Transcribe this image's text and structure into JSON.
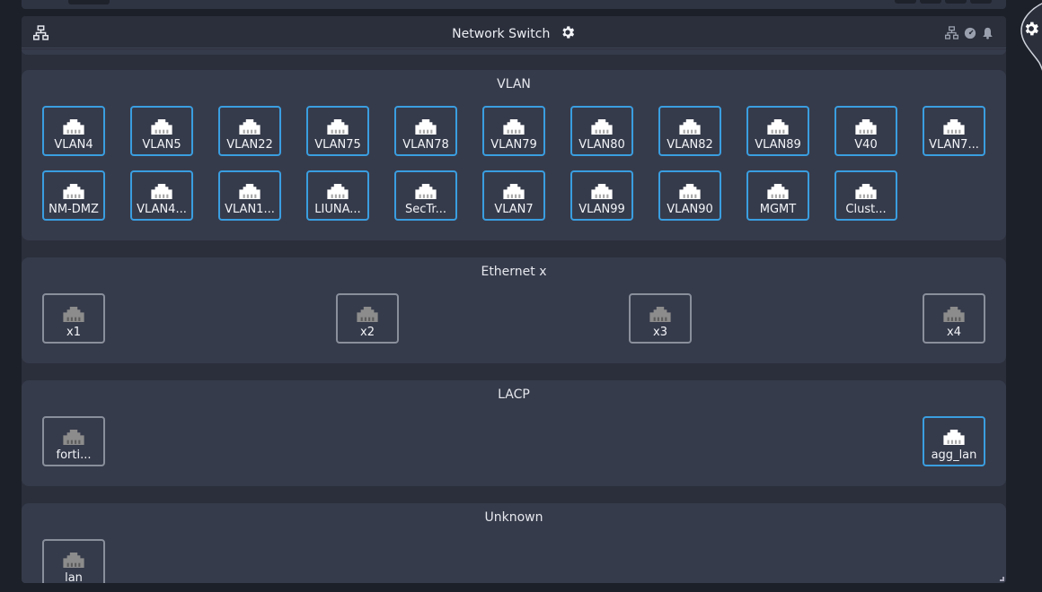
{
  "header": {
    "title": "Network Switch",
    "icons": [
      "network-icon",
      "gear-icon",
      "network-icon",
      "dashboard-icon",
      "bell-icon"
    ]
  },
  "colors": {
    "background": "#1c2028",
    "card": "#2b2f3c",
    "section": "#363b4b",
    "active_border": "#3a9ee0",
    "inactive_border": "#8a8f9c",
    "active_icon": "#ffffff",
    "inactive_icon": "#8c8c8c"
  },
  "sections": {
    "vlan": {
      "title": "VLAN",
      "items": [
        {
          "label": "VLAN4",
          "active": true
        },
        {
          "label": "VLAN5",
          "active": true
        },
        {
          "label": "VLAN22",
          "active": true
        },
        {
          "label": "VLAN75",
          "active": true
        },
        {
          "label": "VLAN78",
          "active": true
        },
        {
          "label": "VLAN79",
          "active": true
        },
        {
          "label": "VLAN80",
          "active": true
        },
        {
          "label": "VLAN82",
          "active": true
        },
        {
          "label": "VLAN89",
          "active": true
        },
        {
          "label": "V40",
          "active": true
        },
        {
          "label": "VLAN7...",
          "active": true
        },
        {
          "label": "NM-DMZ",
          "active": true
        },
        {
          "label": "VLAN4...",
          "active": true
        },
        {
          "label": "VLAN1...",
          "active": true
        },
        {
          "label": "LIUNA...",
          "active": true
        },
        {
          "label": "SecTr...",
          "active": true
        },
        {
          "label": "VLAN7",
          "active": true
        },
        {
          "label": "VLAN99",
          "active": true
        },
        {
          "label": "VLAN90",
          "active": true
        },
        {
          "label": "MGMT",
          "active": true
        },
        {
          "label": "Clust...",
          "active": true
        }
      ]
    },
    "ethernet": {
      "title": "Ethernet x",
      "items": [
        {
          "label": "x1",
          "active": false
        },
        {
          "label": "x2",
          "active": false
        },
        {
          "label": "x3",
          "active": false
        },
        {
          "label": "x4",
          "active": false
        }
      ]
    },
    "lacp": {
      "title": "LACP",
      "items": [
        {
          "label": "forti...",
          "active": false
        },
        {
          "label": "agg_lan",
          "active": true
        }
      ]
    },
    "unknown": {
      "title": "Unknown",
      "items": [
        {
          "label": "lan",
          "active": false
        }
      ]
    }
  }
}
